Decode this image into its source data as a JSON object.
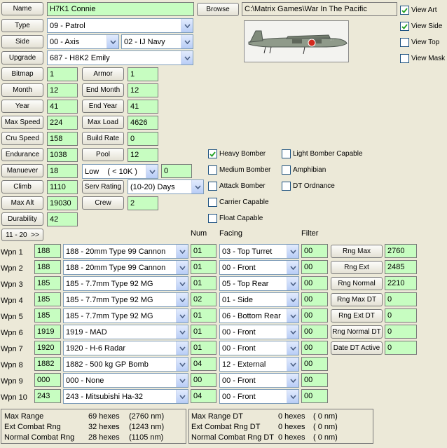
{
  "header": {
    "name_label": "Name",
    "name_value": "H7K1 Connie",
    "browse_label": "Browse",
    "path_value": "C:\\Matrix Games\\War In The Pacific"
  },
  "view_options": [
    {
      "label": "View Art",
      "checked": true
    },
    {
      "label": "View Side",
      "checked": true
    },
    {
      "label": "View Top",
      "checked": false
    },
    {
      "label": "View Mask",
      "checked": false
    }
  ],
  "aircraft_image": {
    "icon": "aircraft-side-art",
    "colors": {
      "fuselage": "#8f9a8a",
      "roundel": "#d22a1e",
      "sky": "#f3f3f0"
    }
  },
  "type": {
    "label": "Type",
    "value": "09 - Patrol"
  },
  "side": {
    "label": "Side",
    "value": "00 - Axis",
    "navy": "02 - IJ Navy"
  },
  "upgrade": {
    "label": "Upgrade",
    "value": "687 - H8K2 Emily"
  },
  "stats": {
    "bitmap": {
      "label": "Bitmap",
      "value": "1"
    },
    "month": {
      "label": "Month",
      "value": "12"
    },
    "year": {
      "label": "Year",
      "value": "41"
    },
    "max_speed": {
      "label": "Max Speed",
      "value": "224"
    },
    "cru_speed": {
      "label": "Cru Speed",
      "value": "158"
    },
    "endurance": {
      "label": "Endurance",
      "value": "1038"
    },
    "manuever": {
      "label": "Manuever",
      "value": "18"
    },
    "climb": {
      "label": "Climb",
      "value": "1110"
    },
    "max_alt": {
      "label": "Max Alt",
      "value": "19030"
    },
    "durability": {
      "label": "Durability",
      "value": "42"
    },
    "armor": {
      "label": "Armor",
      "value": "1"
    },
    "end_month": {
      "label": "End Month",
      "value": "12"
    },
    "end_year": {
      "label": "End Year",
      "value": "41"
    },
    "max_load": {
      "label": "Max Load",
      "value": "4626"
    },
    "build_rate": {
      "label": "Build Rate",
      "value": "0"
    },
    "pool": {
      "label": "Pool",
      "value": "12"
    },
    "altitude_select": "Low    ( < 10K )",
    "altitude_value": "0",
    "serv_rating": {
      "label": "Serv Rating",
      "value": "(10-20) Days"
    },
    "crew": {
      "label": "Crew",
      "value": "2"
    }
  },
  "roles_left": [
    {
      "label": "Heavy Bomber",
      "checked": true
    },
    {
      "label": "Medium Bomber",
      "checked": false
    },
    {
      "label": "Attack Bomber",
      "checked": false
    },
    {
      "label": "Carrier Capable",
      "checked": false
    },
    {
      "label": "Float Capable",
      "checked": false
    }
  ],
  "roles_right": [
    {
      "label": "Light Bomber Capable",
      "checked": false
    },
    {
      "label": "Amphibian",
      "checked": false
    },
    {
      "label": "DT Ordnance",
      "checked": false
    }
  ],
  "page_button": "11 - 20  >>",
  "weapon_headers": {
    "num": "Num",
    "facing": "Facing",
    "filter": "Filter"
  },
  "weapons": [
    {
      "label": "Wpn 1",
      "id": "188",
      "name": "188 - 20mm Type 99 Cannon",
      "num": "01",
      "facing": "03 - Top Turret",
      "filter": "00"
    },
    {
      "label": "Wpn 2",
      "id": "188",
      "name": "188 - 20mm Type 99 Cannon",
      "num": "01",
      "facing": "00 - Front",
      "filter": "00"
    },
    {
      "label": "Wpn 3",
      "id": "185",
      "name": "185 - 7.7mm Type 92 MG",
      "num": "01",
      "facing": "05 - Top Rear",
      "filter": "00"
    },
    {
      "label": "Wpn 4",
      "id": "185",
      "name": "185 - 7.7mm Type 92 MG",
      "num": "02",
      "facing": "01 - Side",
      "filter": "00"
    },
    {
      "label": "Wpn 5",
      "id": "185",
      "name": "185 - 7.7mm Type 92 MG",
      "num": "01",
      "facing": "06 - Bottom Rear",
      "filter": "00"
    },
    {
      "label": "Wpn 6",
      "id": "1919",
      "name": "1919 - MAD",
      "num": "01",
      "facing": "00 - Front",
      "filter": "00"
    },
    {
      "label": "Wpn 7",
      "id": "1920",
      "name": "1920 - H-6 Radar",
      "num": "01",
      "facing": "00 - Front",
      "filter": "00"
    },
    {
      "label": "Wpn 8",
      "id": "1882",
      "name": "1882 - 500 kg GP Bomb",
      "num": "04",
      "facing": "12 - External",
      "filter": "00"
    },
    {
      "label": "Wpn 9",
      "id": "000",
      "name": "000 - None",
      "num": "00",
      "facing": "00 - Front",
      "filter": "00"
    },
    {
      "label": "Wpn 10",
      "id": "243",
      "name": "243 - Mitsubishi Ha-32",
      "num": "04",
      "facing": "00 - Front",
      "filter": "00"
    }
  ],
  "ranges": [
    {
      "label": "Rng Max",
      "value": "2760"
    },
    {
      "label": "Rng Ext",
      "value": "2485"
    },
    {
      "label": "Rng Normal",
      "value": "2210"
    },
    {
      "label": "Rng Max DT",
      "value": "0"
    },
    {
      "label": "Rng Ext DT",
      "value": "0"
    },
    {
      "label": "Rng Normal DT",
      "value": "0"
    },
    {
      "label": "Date DT Active",
      "value": "0"
    }
  ],
  "summary_left": [
    {
      "label": "Max Range",
      "hexes": "69 hexes",
      "nm": "(2760 nm)"
    },
    {
      "label": "Ext Combat Rng",
      "hexes": "32 hexes",
      "nm": "(1243 nm)"
    },
    {
      "label": "Normal Combat Rng",
      "hexes": "28 hexes",
      "nm": "(1105 nm)"
    }
  ],
  "summary_right": [
    {
      "label": "Max Range DT",
      "hexes": "0 hexes",
      "nm": "( 0 nm)"
    },
    {
      "label": "Ext Combat Rng DT",
      "hexes": "0 hexes",
      "nm": "( 0 nm)"
    },
    {
      "label": "Normal Combat Rng DT",
      "hexes": "0 hexes",
      "nm": "( 0 nm)"
    }
  ]
}
